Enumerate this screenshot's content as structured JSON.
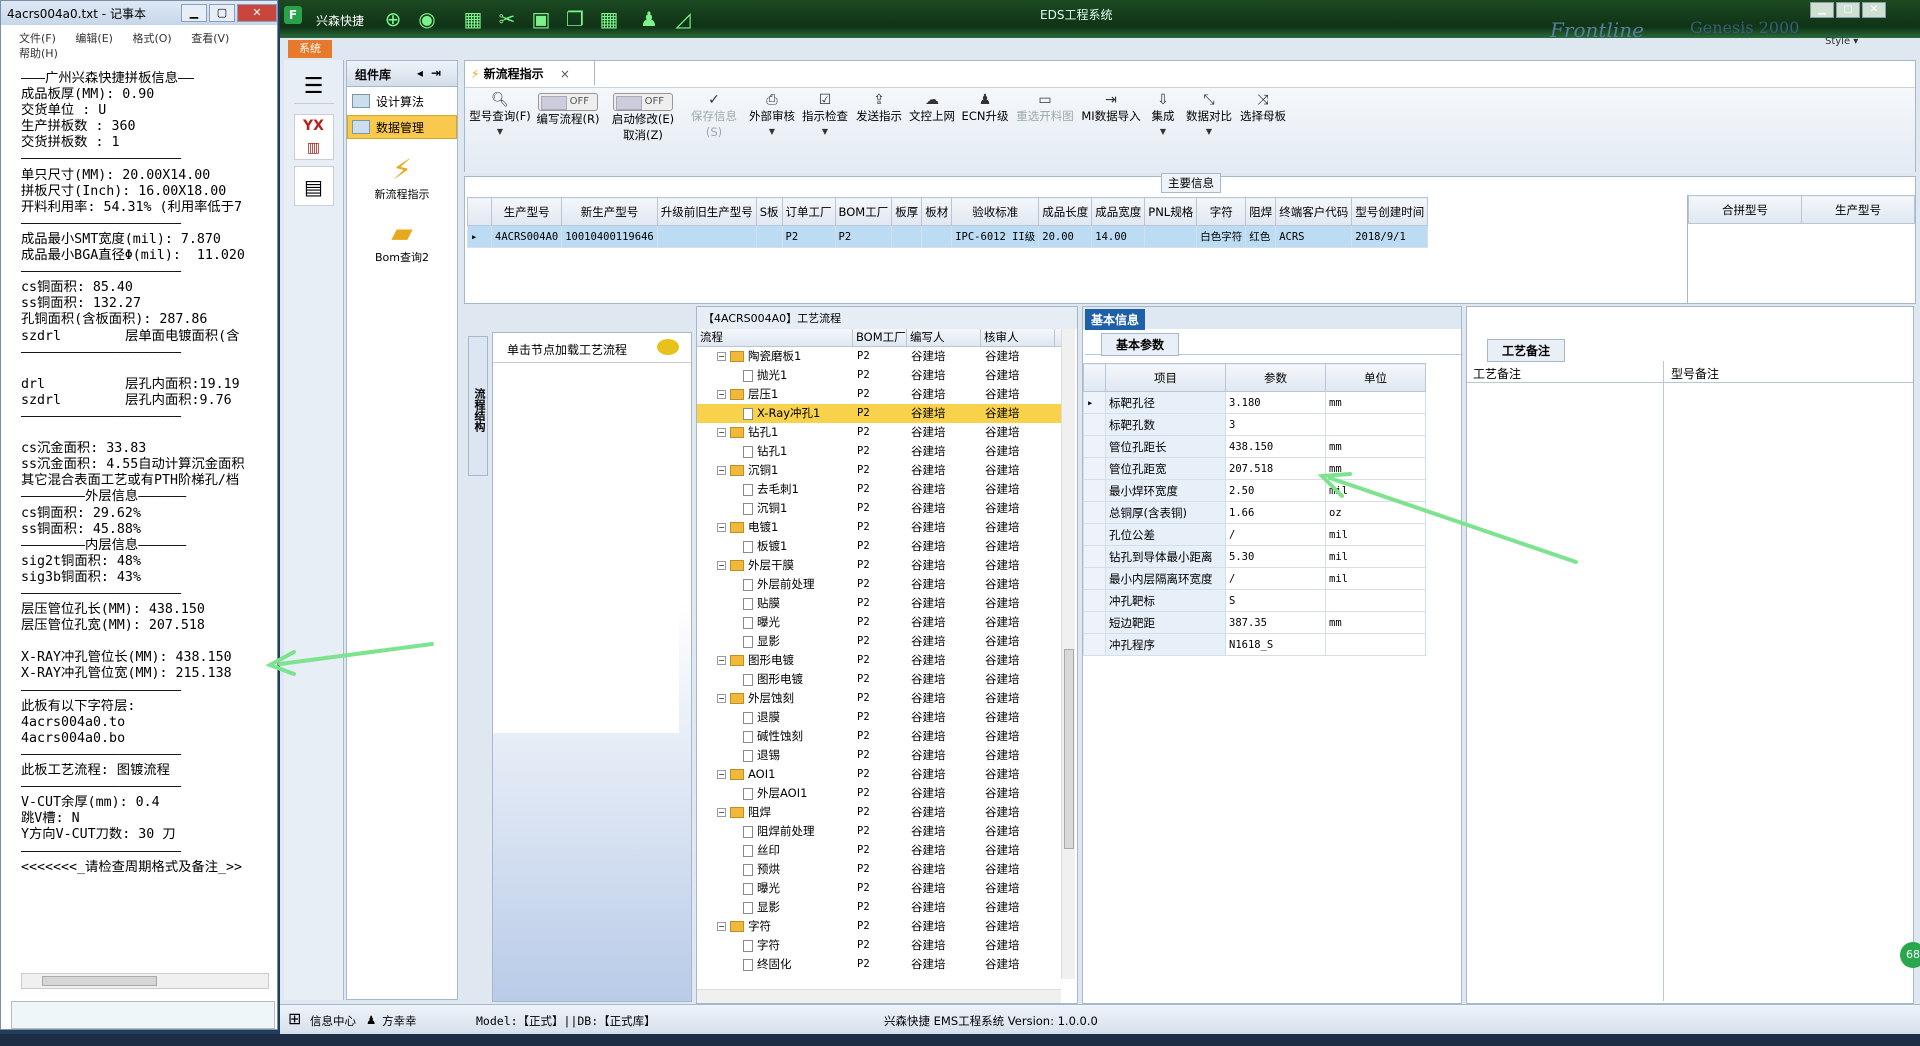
{
  "notepad": {
    "title": "4acrs004a0.txt - 记事本",
    "menu": [
      "文件(F)",
      "编辑(E)",
      "格式(O)",
      "查看(V)",
      "帮助(H)"
    ],
    "lines": [
      "———广州兴森快捷拼板信息——",
      "成品板厚(MM): 0.90",
      "交货单位 : U",
      "生产拼板数 : 360",
      "交货拼板数 : 1",
      "————————————————————",
      "单只尺寸(MM): 20.00X14.00",
      "拼板尺寸(Inch): 16.00X18.00",
      "开料利用率: 54.31% (利用率低于7",
      "————————————————————",
      "成品最小SMT宽度(mil): 7.870",
      "成品最小BGA直径Φ(mil):  11.020",
      "————————————————————",
      "cs铜面积: 85.40",
      "ss铜面积: 132.27",
      "孔铜面积(含板面积): 287.86",
      "szdrl        层单面电镀面积(含",
      "————————————————————",
      "",
      "drl          层孔内面积:19.19",
      "szdrl        层孔内面积:9.76",
      "————————————————————",
      "",
      "cs沉金面积: 33.83",
      "ss沉金面积: 4.55自动计算沉金面积",
      "其它混合表面工艺或有PTH阶梯孔/档",
      "————————外层信息——————",
      "cs铜面积: 29.62%",
      "ss铜面积: 45.88%",
      "————————内层信息——————",
      "sig2t铜面积: 48%",
      "sig3b铜面积: 43%",
      "————————————————————",
      "层压管位孔长(MM): 438.150",
      "层压管位孔宽(MM): 207.518",
      "",
      "X-RAY冲孔管位长(MM): 438.150",
      "X-RAY冲孔管位宽(MM): 215.138",
      "————————————————————",
      "此板有以下字符层:",
      "4acrs004a0.to",
      "4acrs004a0.bo",
      "————————————————————",
      "此板工艺流程: 图镀流程",
      "————————————————————",
      "V-CUT余厚(mm): 0.4",
      "跳V槽: N",
      "Y方向V-CUT刀数: 30 刀",
      "————————————————————",
      "<<<<<<<_请检查周期格式及备注_>>"
    ]
  },
  "app": {
    "title": "EDS工程系统",
    "name": "兴森快捷",
    "brand": "Frontline",
    "brand2": "Genesis 2000",
    "style_label": "Style",
    "system_tab": "系统",
    "strip_yx": "YX",
    "component_panel": {
      "title": "组件库",
      "items": [
        {
          "label": "设计算法",
          "selected": false
        },
        {
          "label": "数据管理",
          "selected": true
        }
      ],
      "big_items": [
        "新流程指示",
        "Bom查询2"
      ]
    },
    "tab": {
      "label": "新流程指示",
      "close": "×"
    },
    "ribbon": {
      "buttons": [
        {
          "label": "型号查询(F)",
          "icon": "search-icon"
        },
        {
          "label": "编写流程(R)",
          "toggle": "OFF"
        },
        {
          "label": "启动修改(E)",
          "sub": "取消(Z)",
          "toggle": "OFF"
        },
        {
          "label": "保存信息(S)",
          "icon": "check-icon",
          "disabled": true
        },
        {
          "label": "外部审核",
          "icon": "print-icon"
        },
        {
          "label": "指示检查",
          "icon": "checkbox-icon"
        },
        {
          "label": "发送指示",
          "icon": "upload-icon"
        },
        {
          "label": "文控上网",
          "icon": "cloud-icon"
        },
        {
          "label": "ECN升级",
          "icon": "ecn-icon"
        },
        {
          "label": "重选开料图",
          "icon": "image-icon",
          "disabled": true
        },
        {
          "label": "MI数据导入",
          "icon": "import-icon"
        },
        {
          "label": "集成",
          "icon": "download-icon"
        },
        {
          "label": "数据对比",
          "icon": "compare-icon"
        },
        {
          "label": "选择母板",
          "icon": "shuffle-icon"
        }
      ]
    },
    "main_info": {
      "title": "主要信息",
      "columns": [
        "生产型号",
        "新生产型号",
        "升级前旧生产型号",
        "S板",
        "订单工厂",
        "BOM工厂",
        "板厚",
        "板材",
        "验收标准",
        "成品长度",
        "成品宽度",
        "PNL规格",
        "字符",
        "阻焊",
        "终端客户代码",
        "型号创建时间"
      ],
      "rows": [
        [
          "4ACRS004A0",
          "10010400119646",
          "",
          "",
          "P2",
          "P2",
          "",
          "",
          "IPC-6012 II级",
          "20.00",
          "14.00",
          "",
          "白色字符",
          "红色",
          "ACRS",
          "2018/9/1"
        ]
      ],
      "right_columns": [
        "合拼型号",
        "生产型号"
      ]
    },
    "side_vertical_tab": "流程结构",
    "click_hint": "单击节点加载工艺流程",
    "process": {
      "title": "【4ACRS004A0】工艺流程",
      "columns": [
        "流程",
        "BOM工厂",
        "编写人",
        "核审人"
      ],
      "rows": [
        {
          "name": "陶瓷磨板1",
          "level": 0,
          "folder": true,
          "bom": "P2",
          "writer": "谷建培",
          "reviewer": "谷建培"
        },
        {
          "name": "抛光1",
          "level": 1,
          "folder": false,
          "bom": "P2",
          "writer": "谷建培",
          "reviewer": "谷建培"
        },
        {
          "name": "层压1",
          "level": 0,
          "folder": true,
          "bom": "P2",
          "writer": "谷建培",
          "reviewer": "谷建培"
        },
        {
          "name": "X-Ray冲孔1",
          "level": 1,
          "folder": false,
          "bom": "P2",
          "writer": "谷建培",
          "reviewer": "谷建培",
          "selected": true
        },
        {
          "name": "钻孔1",
          "level": 0,
          "folder": true,
          "bom": "P2",
          "writer": "谷建培",
          "reviewer": "谷建培"
        },
        {
          "name": "钻孔1",
          "level": 1,
          "folder": false,
          "bom": "P2",
          "writer": "谷建培",
          "reviewer": "谷建培"
        },
        {
          "name": "沉铜1",
          "level": 0,
          "folder": true,
          "bom": "P2",
          "writer": "谷建培",
          "reviewer": "谷建培"
        },
        {
          "name": "去毛刺1",
          "level": 1,
          "folder": false,
          "bom": "P2",
          "writer": "谷建培",
          "reviewer": "谷建培"
        },
        {
          "name": "沉铜1",
          "level": 1,
          "folder": false,
          "bom": "P2",
          "writer": "谷建培",
          "reviewer": "谷建培"
        },
        {
          "name": "电镀1",
          "level": 0,
          "folder": true,
          "bom": "P2",
          "writer": "谷建培",
          "reviewer": "谷建培"
        },
        {
          "name": "板镀1",
          "level": 1,
          "folder": false,
          "bom": "P2",
          "writer": "谷建培",
          "reviewer": "谷建培"
        },
        {
          "name": "外层干膜",
          "level": 0,
          "folder": true,
          "bom": "P2",
          "writer": "谷建培",
          "reviewer": "谷建培"
        },
        {
          "name": "外层前处理",
          "level": 1,
          "folder": false,
          "bom": "P2",
          "writer": "谷建培",
          "reviewer": "谷建培"
        },
        {
          "name": "贴膜",
          "level": 1,
          "folder": false,
          "bom": "P2",
          "writer": "谷建培",
          "reviewer": "谷建培"
        },
        {
          "name": "曝光",
          "level": 1,
          "folder": false,
          "bom": "P2",
          "writer": "谷建培",
          "reviewer": "谷建培"
        },
        {
          "name": "显影",
          "level": 1,
          "folder": false,
          "bom": "P2",
          "writer": "谷建培",
          "reviewer": "谷建培"
        },
        {
          "name": "图形电镀",
          "level": 0,
          "folder": true,
          "bom": "P2",
          "writer": "谷建培",
          "reviewer": "谷建培"
        },
        {
          "name": "图形电镀",
          "level": 1,
          "folder": false,
          "bom": "P2",
          "writer": "谷建培",
          "reviewer": "谷建培"
        },
        {
          "name": "外层蚀刻",
          "level": 0,
          "folder": true,
          "bom": "P2",
          "writer": "谷建培",
          "reviewer": "谷建培"
        },
        {
          "name": "退膜",
          "level": 1,
          "folder": false,
          "bom": "P2",
          "writer": "谷建培",
          "reviewer": "谷建培"
        },
        {
          "name": "碱性蚀刻",
          "level": 1,
          "folder": false,
          "bom": "P2",
          "writer": "谷建培",
          "reviewer": "谷建培"
        },
        {
          "name": "退锡",
          "level": 1,
          "folder": false,
          "bom": "P2",
          "writer": "谷建培",
          "reviewer": "谷建培"
        },
        {
          "name": "AOI1",
          "level": 0,
          "folder": true,
          "bom": "P2",
          "writer": "谷建培",
          "reviewer": "谷建培"
        },
        {
          "name": "外层AOI1",
          "level": 1,
          "folder": false,
          "bom": "P2",
          "writer": "谷建培",
          "reviewer": "谷建培"
        },
        {
          "name": "阻焊",
          "level": 0,
          "folder": true,
          "bom": "P2",
          "writer": "谷建培",
          "reviewer": "谷建培"
        },
        {
          "name": "阻焊前处理",
          "level": 1,
          "folder": false,
          "bom": "P2",
          "writer": "谷建培",
          "reviewer": "谷建培"
        },
        {
          "name": "丝印",
          "level": 1,
          "folder": false,
          "bom": "P2",
          "writer": "谷建培",
          "reviewer": "谷建培"
        },
        {
          "name": "预烘",
          "level": 1,
          "folder": false,
          "bom": "P2",
          "writer": "谷建培",
          "reviewer": "谷建培"
        },
        {
          "name": "曝光",
          "level": 1,
          "folder": false,
          "bom": "P2",
          "writer": "谷建培",
          "reviewer": "谷建培"
        },
        {
          "name": "显影",
          "level": 1,
          "folder": false,
          "bom": "P2",
          "writer": "谷建培",
          "reviewer": "谷建培"
        },
        {
          "name": "字符",
          "level": 0,
          "folder": true,
          "bom": "P2",
          "writer": "谷建培",
          "reviewer": "谷建培"
        },
        {
          "name": "字符",
          "level": 1,
          "folder": false,
          "bom": "P2",
          "writer": "谷建培",
          "reviewer": "谷建培"
        },
        {
          "name": "终固化",
          "level": 1,
          "folder": false,
          "bom": "P2",
          "writer": "谷建培",
          "reviewer": "谷建培"
        }
      ]
    },
    "basic_info": {
      "tab": "基本信息",
      "subtab": "基本参数",
      "columns": [
        "项目",
        "参数",
        "单位"
      ],
      "rows": [
        [
          "标靶孔径",
          "3.180",
          "mm"
        ],
        [
          "标靶孔数",
          "3",
          ""
        ],
        [
          "管位孔距长",
          "438.150",
          "mm"
        ],
        [
          "管位孔距宽",
          "207.518",
          "mm"
        ],
        [
          "最小焊环宽度",
          "2.50",
          "mil"
        ],
        [
          "总铜厚(含表铜)",
          "1.66",
          "oz"
        ],
        [
          "孔位公差",
          "/",
          "mil"
        ],
        [
          "钻孔到导体最小距离",
          "5.30",
          "mil"
        ],
        [
          "最小内层隔离环宽度",
          "/",
          "mil"
        ],
        [
          "冲孔靶标",
          "S",
          ""
        ],
        [
          "短边靶距",
          "387.35",
          "mm"
        ],
        [
          "冲孔程序",
          "N1618_S",
          ""
        ]
      ]
    },
    "remarks": {
      "tab": "工艺备注",
      "col1": "工艺备注",
      "col2": "型号备注"
    },
    "status": {
      "info_center": "信息中心",
      "user": "方幸幸",
      "model": "Model:【正式】||DB:【正式库】",
      "version": "兴森快捷 EMS工程系统 Version: 1.0.0.0"
    },
    "badge": "68",
    "colors": {
      "accent": "#1f5fa8",
      "selected_row": "#f7d24a",
      "title_bar": "#0f3316",
      "arrow": "#7de38f"
    }
  }
}
